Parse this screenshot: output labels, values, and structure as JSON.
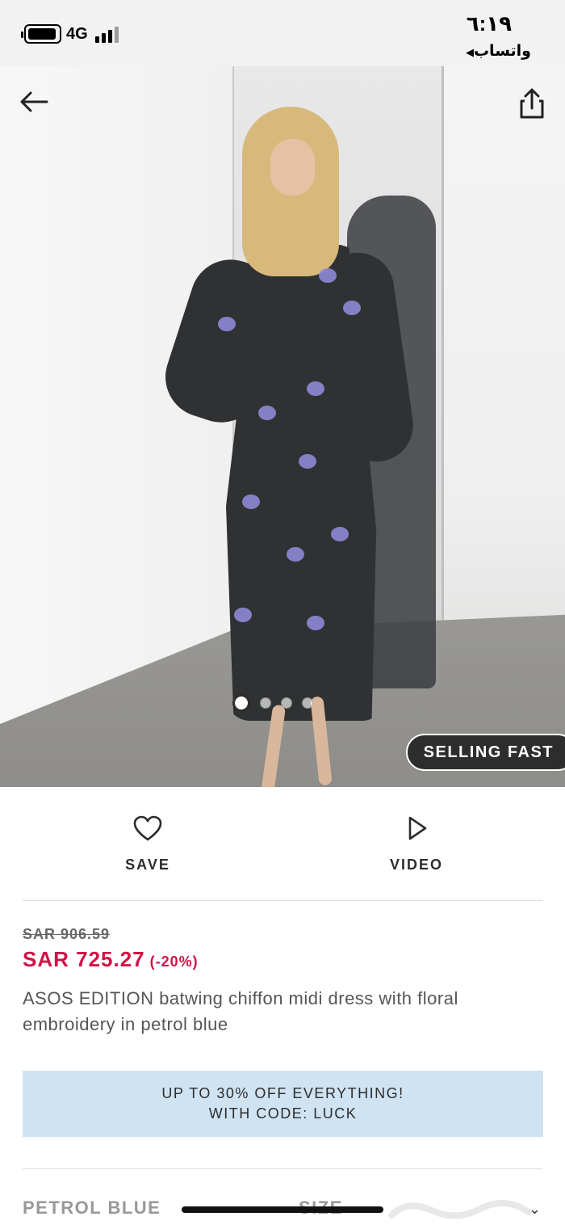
{
  "status_bar": {
    "network": "4G",
    "time": "٦:١٩",
    "back_app": "واتساب",
    "back_icon": "triangle-left-icon"
  },
  "hero": {
    "badge": "SELLING FAST",
    "image_count": 4,
    "active_index": 0
  },
  "actions": {
    "save_label": "SAVE",
    "video_label": "VIDEO"
  },
  "product": {
    "old_price": "SAR 906.59",
    "price": "SAR 725.27",
    "discount": "(-20%)",
    "title": "ASOS EDITION batwing chiffon midi dress with floral embroidery in petrol blue"
  },
  "promo": {
    "line1": "UP TO 30% OFF EVERYTHING!",
    "line2": "WITH CODE: LUCK"
  },
  "options": {
    "colour": "PETROL BLUE",
    "size": "SIZE"
  },
  "colors": {
    "price": "#d01345",
    "promo_bg": "#cfe3f3",
    "badge_bg": "#2d2d2d",
    "dress": "#2f3133",
    "embroidery": "#8f88d6"
  }
}
